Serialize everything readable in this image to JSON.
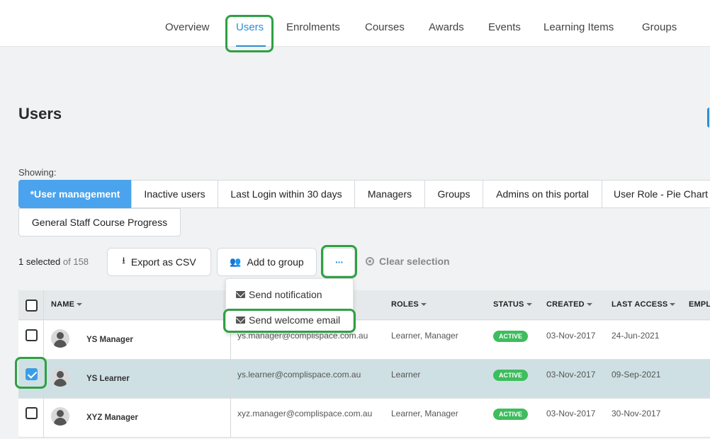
{
  "topnav": {
    "tabs": [
      {
        "label": "Overview"
      },
      {
        "label": "Users"
      },
      {
        "label": "Enrolments"
      },
      {
        "label": "Courses"
      },
      {
        "label": "Awards"
      },
      {
        "label": "Events"
      },
      {
        "label": "Learning Items"
      },
      {
        "label": "Groups"
      }
    ],
    "active": "Users"
  },
  "page": {
    "title": "Users"
  },
  "views": {
    "showing_label": "Showing:",
    "items": [
      {
        "label": "*User management",
        "active": true
      },
      {
        "label": "Inactive users"
      },
      {
        "label": "Last Login within 30 days"
      },
      {
        "label": "Managers"
      },
      {
        "label": "Groups"
      },
      {
        "label": "Admins on this portal"
      },
      {
        "label": "User Role - Pie Chart"
      },
      {
        "label": "General Staff Course Progress"
      }
    ]
  },
  "toolbar": {
    "selected_count": "1 selected",
    "total": "of 158",
    "export_label": "Export as CSV",
    "add_group_label": "Add to group",
    "more_label": "···",
    "clear_label": "Clear selection"
  },
  "menu": {
    "items": [
      {
        "label": "Send notification",
        "icon": "envelope-icon"
      },
      {
        "label": "Send welcome email",
        "icon": "envelope-icon"
      }
    ]
  },
  "table": {
    "columns": [
      "NAME",
      "ROLES",
      "STATUS",
      "CREATED",
      "LAST ACCESS",
      "EMPL"
    ],
    "rows": [
      {
        "name": "YS Manager",
        "email": "ys.manager@complispace.com.au",
        "roles": "Learner, Manager",
        "status": "ACTIVE",
        "created": "03-Nov-2017",
        "last_access": "24-Jun-2021",
        "selected": false
      },
      {
        "name": "YS Learner",
        "email": "ys.learner@complispace.com.au",
        "roles": "Learner",
        "status": "ACTIVE",
        "created": "03-Nov-2017",
        "last_access": "09-Sep-2021",
        "selected": true
      },
      {
        "name": "XYZ Manager",
        "email": "xyz.manager@complispace.com.au",
        "roles": "Learner, Manager",
        "status": "ACTIVE",
        "created": "03-Nov-2017",
        "last_access": "30-Nov-2017",
        "selected": false
      }
    ]
  },
  "colors": {
    "accent": "#2b8fd6",
    "active_view": "#4aa3ec",
    "badge": "#3ebd5d",
    "highlight": "#2fa043",
    "selected_row": "#cfe0e4"
  }
}
